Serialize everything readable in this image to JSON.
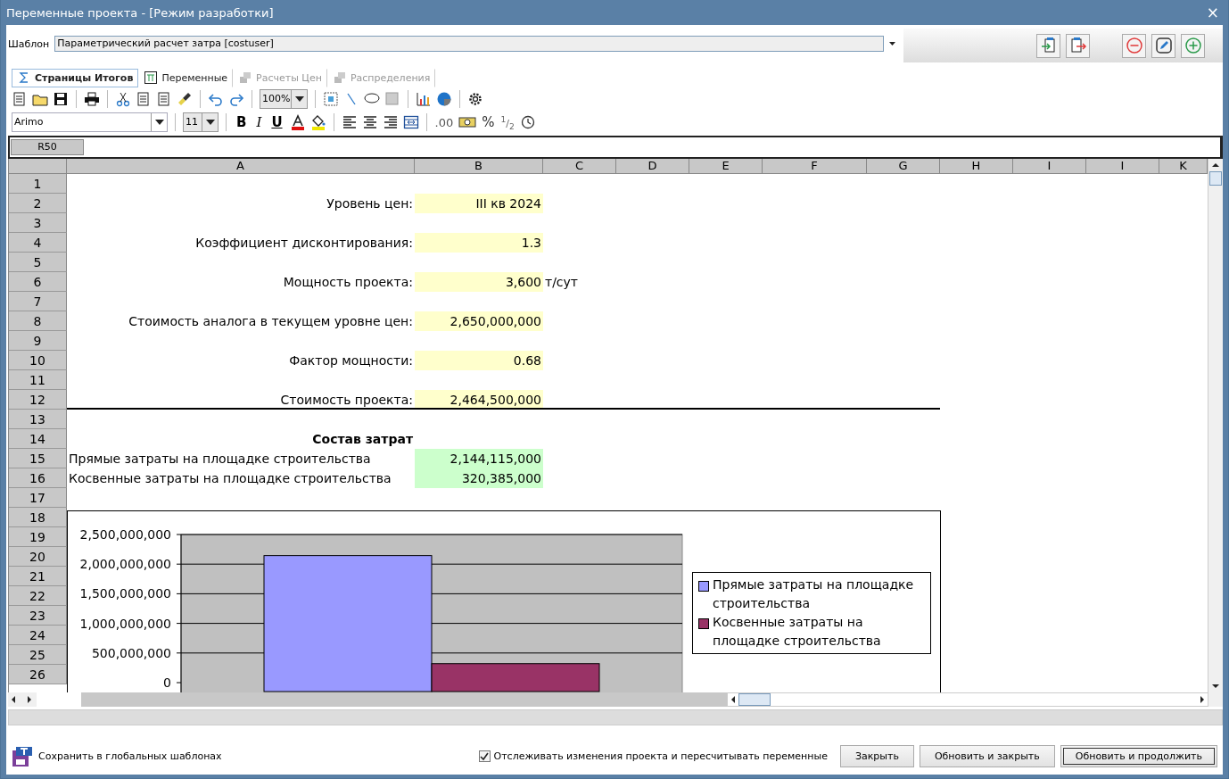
{
  "window": {
    "title": "Переменные проекта - [Режим разработки]",
    "close": "×"
  },
  "template": {
    "label": "Шаблон",
    "value": "Параметрический расчет затра [costuser]"
  },
  "tabs": [
    {
      "label": "Страницы Итогов",
      "selected": true,
      "disabled": false,
      "kind": "sum"
    },
    {
      "label": "Переменные",
      "selected": false,
      "disabled": false,
      "kind": "pi"
    },
    {
      "label": "Расчеты Цен",
      "selected": false,
      "disabled": true,
      "kind": "calc"
    },
    {
      "label": "Распределения",
      "selected": false,
      "disabled": true,
      "kind": "calc"
    }
  ],
  "toolbar": {
    "zoom": "100%",
    "font": "Arimo",
    "font_size": "11",
    "bold": "B",
    "italic": "I",
    "underline": "U",
    "decimals": ".00",
    "percent": "%",
    "fraction_num": "1",
    "fraction_sep": "/",
    "fraction_den": "2"
  },
  "cell_ref": "R50",
  "sheet": {
    "columns": [
      "A",
      "B",
      "C",
      "D",
      "E",
      "F",
      "G",
      "H",
      "I",
      "I",
      "K"
    ],
    "rows": [
      {
        "number": "1",
        "border_below": false
      },
      {
        "number": "2",
        "kind": "param",
        "a": "Уровень цен:",
        "b": "III кв 2024",
        "border_below": false
      },
      {
        "number": "3",
        "border_below": false
      },
      {
        "number": "4",
        "kind": "param",
        "a": "Коэффициент дисконтирования:",
        "b": "1.3",
        "border_below": false
      },
      {
        "number": "5",
        "border_below": false
      },
      {
        "number": "6",
        "kind": "param",
        "a": "Мощность проекта:",
        "b": "3,600",
        "c": "т/сут",
        "border_below": false
      },
      {
        "number": "7",
        "border_below": false
      },
      {
        "number": "8",
        "kind": "param",
        "a": "Стоимость аналога в текущем уровне цен:",
        "b": "2,650,000,000",
        "border_below": false
      },
      {
        "number": "9",
        "border_below": false
      },
      {
        "number": "10",
        "kind": "param",
        "a": "Фактор мощности:",
        "b": "0.68",
        "border_below": false
      },
      {
        "number": "11",
        "border_below": false
      },
      {
        "number": "12",
        "kind": "param",
        "a": "Стоимость проекта:",
        "b": "2,464,500,000",
        "border_below": true
      },
      {
        "number": "13",
        "border_below": false
      },
      {
        "number": "14",
        "kind": "heading",
        "a": "Состав затрат",
        "border_below": false
      },
      {
        "number": "15",
        "kind": "cost",
        "a": "Прямые затраты на площадке строительства",
        "b": "2,144,115,000",
        "border_below": false
      },
      {
        "number": "16",
        "kind": "cost",
        "a": "Косвенные затраты на площадке строительства",
        "b": "320,385,000",
        "border_below": false
      },
      {
        "number": "17",
        "border_below": false
      },
      {
        "number": "18"
      },
      {
        "number": "19"
      },
      {
        "number": "20"
      },
      {
        "number": "21"
      },
      {
        "number": "22"
      },
      {
        "number": "23"
      },
      {
        "number": "24"
      },
      {
        "number": "25"
      },
      {
        "number": "26"
      }
    ],
    "chart_data": {
      "type": "bar",
      "categories": [
        null
      ],
      "grid": true,
      "legend": true,
      "series": [
        {
          "name": "Прямые затраты на площадке строительства",
          "color": "#9999ff",
          "values": [
            2144115000
          ]
        },
        {
          "name": "Косвенные затраты на площадке строительства",
          "color": "#993366",
          "values": [
            320385000
          ]
        }
      ],
      "ylim": [
        0,
        2500000000
      ],
      "yticks": [
        {
          "value": 0,
          "label": "0"
        },
        {
          "value": 500000000,
          "label": "500,000,000"
        },
        {
          "value": 1000000000,
          "label": "1,000,000,000"
        },
        {
          "value": 1500000000,
          "label": "1,500,000,000"
        },
        {
          "value": 2000000000,
          "label": "2,000,000,000"
        },
        {
          "value": 2500000000,
          "label": "2,500,000,000"
        }
      ]
    }
  },
  "footer": {
    "save_link": "Сохранить в глобальных шаблонах",
    "track": {
      "label": "Отслеживать изменения проекта и пересчитывать переменные",
      "checked": true
    },
    "buttons": [
      {
        "label": "Закрыть",
        "selected": false
      },
      {
        "label": "Обновить и закрыть",
        "selected": false
      },
      {
        "label": "Обновить и продолжить",
        "selected": true
      }
    ]
  }
}
